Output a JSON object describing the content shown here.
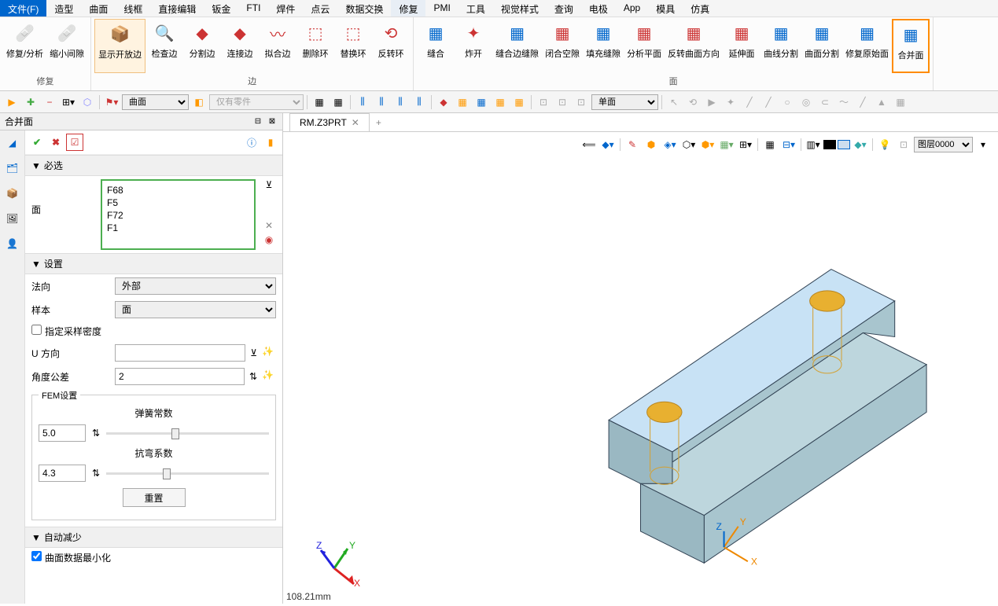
{
  "menu": {
    "file": "文件(F)",
    "items": [
      "造型",
      "曲面",
      "线框",
      "直接编辑",
      "钣金",
      "FTI",
      "焊件",
      "点云",
      "数据交换",
      "修复",
      "PMI",
      "工具",
      "视觉样式",
      "查询",
      "电极",
      "App",
      "模具",
      "仿真"
    ],
    "active_index": 9
  },
  "ribbon": {
    "groups": [
      {
        "label": "修复",
        "items": [
          {
            "label": "修复/分析",
            "icon": "🩹",
            "color": "#d32"
          },
          {
            "label": "缩小间隙",
            "icon": "🩹",
            "color": "#d32"
          }
        ]
      },
      {
        "label": "边",
        "items": [
          {
            "label": "显示开放边",
            "icon": "📦",
            "color": "#06c",
            "hl": true
          },
          {
            "label": "检查边",
            "icon": "🔍",
            "color": "#06c"
          },
          {
            "label": "分割边",
            "icon": "◆",
            "color": "#c33"
          },
          {
            "label": "连接边",
            "icon": "◆",
            "color": "#c33"
          },
          {
            "label": "拟合边",
            "icon": "〰",
            "color": "#c33"
          },
          {
            "label": "删除环",
            "icon": "⬚",
            "color": "#c33"
          },
          {
            "label": "替换环",
            "icon": "⬚",
            "color": "#c33"
          },
          {
            "label": "反转环",
            "icon": "⟲",
            "color": "#c33"
          }
        ]
      },
      {
        "label": "面",
        "items": [
          {
            "label": "缝合",
            "icon": "▦",
            "color": "#06c"
          },
          {
            "label": "炸开",
            "icon": "✦",
            "color": "#c33"
          },
          {
            "label": "缝合边缝隙",
            "icon": "▦",
            "color": "#06c"
          },
          {
            "label": "闭合空隙",
            "icon": "▦",
            "color": "#c33"
          },
          {
            "label": "填充缝隙",
            "icon": "▦",
            "color": "#06c"
          },
          {
            "label": "分析平面",
            "icon": "▦",
            "color": "#c33"
          },
          {
            "label": "反转曲面方向",
            "icon": "▦",
            "color": "#c33"
          },
          {
            "label": "延伸面",
            "icon": "▦",
            "color": "#c33"
          },
          {
            "label": "曲线分割",
            "icon": "▦",
            "color": "#06c"
          },
          {
            "label": "曲面分割",
            "icon": "▦",
            "color": "#06c"
          },
          {
            "label": "修复原始面",
            "icon": "▦",
            "color": "#06c"
          },
          {
            "label": "合并面",
            "icon": "▦",
            "color": "#06c",
            "sel": true
          }
        ]
      }
    ]
  },
  "quickbar": {
    "dropdown1": "曲面",
    "dropdown2": "仅有零件",
    "dropdown3": "单面"
  },
  "panel": {
    "title": "合并面",
    "section_required": "必选",
    "face_label": "面",
    "faces": [
      "F68",
      "F5",
      "F72",
      "F1"
    ],
    "section_settings": "设置",
    "normal_label": "法向",
    "normal_value": "外部",
    "sample_label": "样本",
    "sample_value": "面",
    "density_label": "指定采样密度",
    "udir_label": "U 方向",
    "angle_label": "角度公差",
    "angle_value": "2",
    "fem_title": "FEM设置",
    "spring_label": "弹簧常数",
    "spring_value": "5.0",
    "bend_label": "抗弯系数",
    "bend_value": "4.3",
    "reset_label": "重置",
    "section_auto": "自动减少",
    "minimize_label": "曲面数据最小化"
  },
  "tab": {
    "name": "RM.Z3PRT"
  },
  "layer": {
    "value": "图层0000"
  },
  "measure": "108.21mm"
}
